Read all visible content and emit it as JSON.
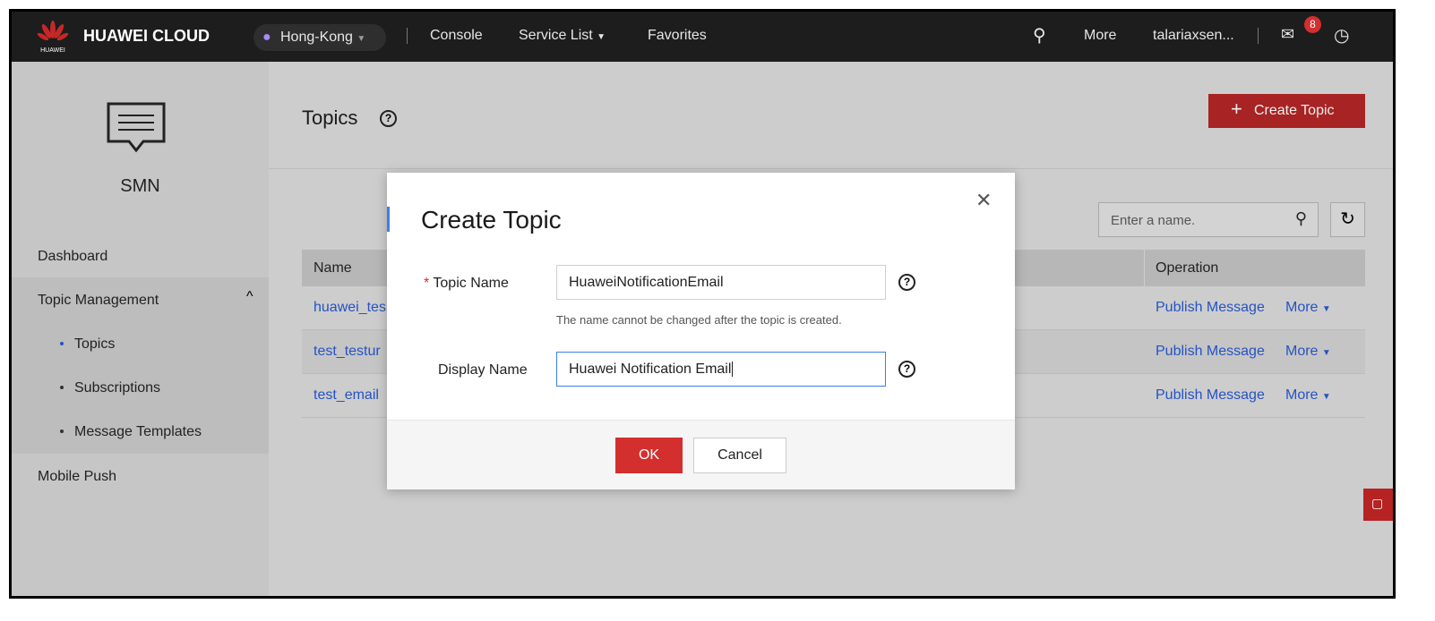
{
  "header": {
    "logo_text": "HUAWEI",
    "brand": "HUAWEI CLOUD",
    "region": "Hong-Kong",
    "nav": [
      "Console",
      "Service List",
      "Favorites"
    ],
    "more": "More",
    "user": "talariaxsen...",
    "message_count": "8"
  },
  "sidebar": {
    "service": "SMN",
    "items": [
      {
        "label": "Dashboard"
      },
      {
        "label": "Topic Management"
      },
      {
        "label": "Mobile Push"
      }
    ],
    "subitems": [
      {
        "label": "Topics"
      },
      {
        "label": "Subscriptions"
      },
      {
        "label": "Message Templates"
      }
    ]
  },
  "page": {
    "title": "Topics",
    "create_label": "Create Topic",
    "search_placeholder": "Enter a name."
  },
  "table": {
    "columns": [
      "Name",
      "Operation"
    ],
    "rows": [
      {
        "name": "huawei_tes",
        "op": "Publish Message",
        "more": "More"
      },
      {
        "name": "test_testur",
        "op": "Publish Message",
        "more": "More"
      },
      {
        "name": "test_email",
        "op": "Publish Message",
        "more": "More"
      }
    ]
  },
  "dialog": {
    "title": "Create Topic",
    "topic_name_label": "Topic Name",
    "topic_name_value": "HuaweiNotificationEmail",
    "topic_name_hint": "The name cannot be changed after the topic is created.",
    "display_name_label": "Display Name",
    "display_name_value": "Huawei Notification Email",
    "ok": "OK",
    "cancel": "Cancel"
  },
  "colors": {
    "brand_red": "#d32f2f",
    "link": "#2553c4",
    "focus": "#3a7ef0"
  }
}
